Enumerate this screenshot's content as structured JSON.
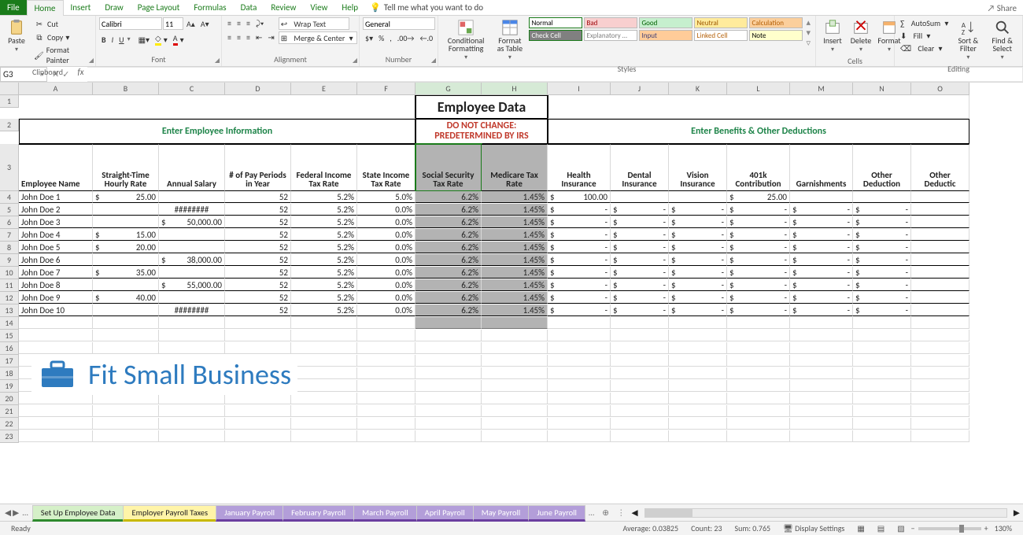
{
  "menu": {
    "file": "File",
    "tabs": [
      "Home",
      "Insert",
      "Draw",
      "Page Layout",
      "Formulas",
      "Data",
      "Review",
      "View",
      "Help"
    ],
    "active": "Home",
    "tellme": "Tell me what you want to do",
    "share": "Share"
  },
  "ribbon": {
    "clipboard": {
      "paste": "Paste",
      "cut": "Cut",
      "copy": "Copy",
      "fp": "Format Painter",
      "label": "Clipboard"
    },
    "font": {
      "name": "Calibri",
      "size": "11",
      "label": "Font",
      "bold": "B",
      "italic": "I",
      "underline": "U"
    },
    "alignment": {
      "wrap": "Wrap Text",
      "merge": "Merge & Center",
      "label": "Alignment"
    },
    "number": {
      "format": "General",
      "label": "Number"
    },
    "styles": {
      "cond": "Conditional Formatting",
      "fat": "Format as Table",
      "cells": {
        "normal": {
          "t": "Normal",
          "bg": "#ffffff",
          "fg": "#000"
        },
        "bad": {
          "t": "Bad",
          "bg": "#f8cfcf",
          "fg": "#9c0006"
        },
        "good": {
          "t": "Good",
          "bg": "#c6efce",
          "fg": "#006100"
        },
        "neutral": {
          "t": "Neutral",
          "bg": "#ffeb9c",
          "fg": "#9c5700"
        },
        "calc": {
          "t": "Calculation",
          "bg": "#fbcf9c",
          "fg": "#b45f06"
        },
        "check": {
          "t": "Check Cell",
          "bg": "#808080",
          "fg": "#ffffff"
        },
        "explan": {
          "t": "Explanatory …",
          "bg": "#ffffff",
          "fg": "#7f7f7f"
        },
        "input": {
          "t": "Input",
          "bg": "#ffcc99",
          "fg": "#3f3f76"
        },
        "linked": {
          "t": "Linked Cell",
          "bg": "#ffffff",
          "fg": "#b45f06"
        },
        "note": {
          "t": "Note",
          "bg": "#ffffcc",
          "fg": "#000000"
        }
      },
      "label": "Styles"
    },
    "cells": {
      "insert": "Insert",
      "delete": "Delete",
      "format": "Format",
      "label": "Cells"
    },
    "editing": {
      "autosum": "AutoSum",
      "fill": "Fill",
      "clear": "Clear",
      "sort": "Sort & Filter",
      "find": "Find & Select",
      "label": "Editing"
    }
  },
  "namebox": "G3",
  "columns": [
    "A",
    "B",
    "C",
    "D",
    "E",
    "F",
    "G",
    "H",
    "I",
    "J",
    "K",
    "L",
    "M",
    "N",
    "O"
  ],
  "row1_title": "Employee Data",
  "row2": {
    "left": "Enter Employee Information",
    "mid1": "DO NOT CHANGE:",
    "mid2": "PREDETERMINED BY IRS",
    "right": "Enter Benefits & Other Deductions"
  },
  "hdr3": [
    "Employee  Name",
    "Straight-Time Hourly Rate",
    "Annual Salary",
    "# of Pay Periods in Year",
    "Federal Income Tax Rate",
    "State Income Tax Rate",
    "Social Security Tax Rate",
    "Medicare Tax Rate",
    "Health Insurance",
    "Dental Insurance",
    "Vision Insurance",
    "401k Contribution",
    "Garnishments",
    "Other Deduction",
    "Other Deductic"
  ],
  "rows": [
    {
      "r": 4,
      "a": "John Doe 1",
      "b": "25.00",
      "c": "",
      "d": "52",
      "e": "5.2%",
      "f": "5.0%",
      "g": "6.2%",
      "h": "1.45%",
      "i": "100.00",
      "j": "",
      "k": "",
      "l": "25.00",
      "m": "",
      "n": "",
      "o": ""
    },
    {
      "r": 5,
      "a": "John Doe 2",
      "b": "",
      "c": "########",
      "d": "52",
      "e": "5.2%",
      "f": "0.0%",
      "g": "6.2%",
      "h": "1.45%",
      "i": "-",
      "j": "-",
      "k": "-",
      "l": "-",
      "m": "-",
      "n": "-",
      "o": ""
    },
    {
      "r": 6,
      "a": "John Doe 3",
      "b": "",
      "c": "50,000.00",
      "d": "52",
      "e": "5.2%",
      "f": "0.0%",
      "g": "6.2%",
      "h": "1.45%",
      "i": "-",
      "j": "-",
      "k": "-",
      "l": "-",
      "m": "-",
      "n": "-",
      "o": ""
    },
    {
      "r": 7,
      "a": "John Doe 4",
      "b": "15.00",
      "c": "",
      "d": "52",
      "e": "5.2%",
      "f": "0.0%",
      "g": "6.2%",
      "h": "1.45%",
      "i": "-",
      "j": "-",
      "k": "-",
      "l": "-",
      "m": "-",
      "n": "-",
      "o": ""
    },
    {
      "r": 8,
      "a": "John Doe 5",
      "b": "20.00",
      "c": "",
      "d": "52",
      "e": "5.2%",
      "f": "0.0%",
      "g": "6.2%",
      "h": "1.45%",
      "i": "-",
      "j": "-",
      "k": "-",
      "l": "-",
      "m": "-",
      "n": "-",
      "o": ""
    },
    {
      "r": 9,
      "a": "John Doe 6",
      "b": "",
      "c": "38,000.00",
      "d": "52",
      "e": "5.2%",
      "f": "0.0%",
      "g": "6.2%",
      "h": "1.45%",
      "i": "-",
      "j": "-",
      "k": "-",
      "l": "-",
      "m": "-",
      "n": "-",
      "o": ""
    },
    {
      "r": 10,
      "a": "John Doe 7",
      "b": "35.00",
      "c": "",
      "d": "52",
      "e": "5.2%",
      "f": "0.0%",
      "g": "6.2%",
      "h": "1.45%",
      "i": "-",
      "j": "-",
      "k": "-",
      "l": "-",
      "m": "-",
      "n": "-",
      "o": ""
    },
    {
      "r": 11,
      "a": "John Doe 8",
      "b": "",
      "c": "55,000.00",
      "d": "52",
      "e": "5.2%",
      "f": "0.0%",
      "g": "6.2%",
      "h": "1.45%",
      "i": "-",
      "j": "-",
      "k": "-",
      "l": "-",
      "m": "-",
      "n": "-",
      "o": ""
    },
    {
      "r": 12,
      "a": "John Doe 9",
      "b": "40.00",
      "c": "",
      "d": "52",
      "e": "5.2%",
      "f": "0.0%",
      "g": "6.2%",
      "h": "1.45%",
      "i": "-",
      "j": "-",
      "k": "-",
      "l": "-",
      "m": "-",
      "n": "-",
      "o": ""
    },
    {
      "r": 13,
      "a": "John Doe 10",
      "b": "",
      "c": "########",
      "d": "52",
      "e": "5.2%",
      "f": "0.0%",
      "g": "6.2%",
      "h": "1.45%",
      "i": "-",
      "j": "-",
      "k": "-",
      "l": "-",
      "m": "-",
      "n": "-",
      "o": ""
    }
  ],
  "empty_rows": [
    14,
    15,
    16,
    17,
    18,
    19,
    20,
    21,
    22,
    23
  ],
  "wtabs": [
    {
      "t": "Set Up Employee Data",
      "c": "green"
    },
    {
      "t": "Employer Payroll Taxes",
      "c": "yellow"
    },
    {
      "t": "January Payroll",
      "c": "purple"
    },
    {
      "t": "February Payroll",
      "c": "purple"
    },
    {
      "t": "March Payroll",
      "c": "purple"
    },
    {
      "t": "April Payroll",
      "c": "purple"
    },
    {
      "t": "May Payroll",
      "c": "purple"
    },
    {
      "t": "June Payroll",
      "c": "purple"
    }
  ],
  "status": {
    "ready": "Ready",
    "avg": "Average: 0.03825",
    "count": "Count: 23",
    "sum": "Sum: 0.765",
    "ds": "Display Settings",
    "zoom": "130%"
  },
  "fsb": "Fit Small Business"
}
